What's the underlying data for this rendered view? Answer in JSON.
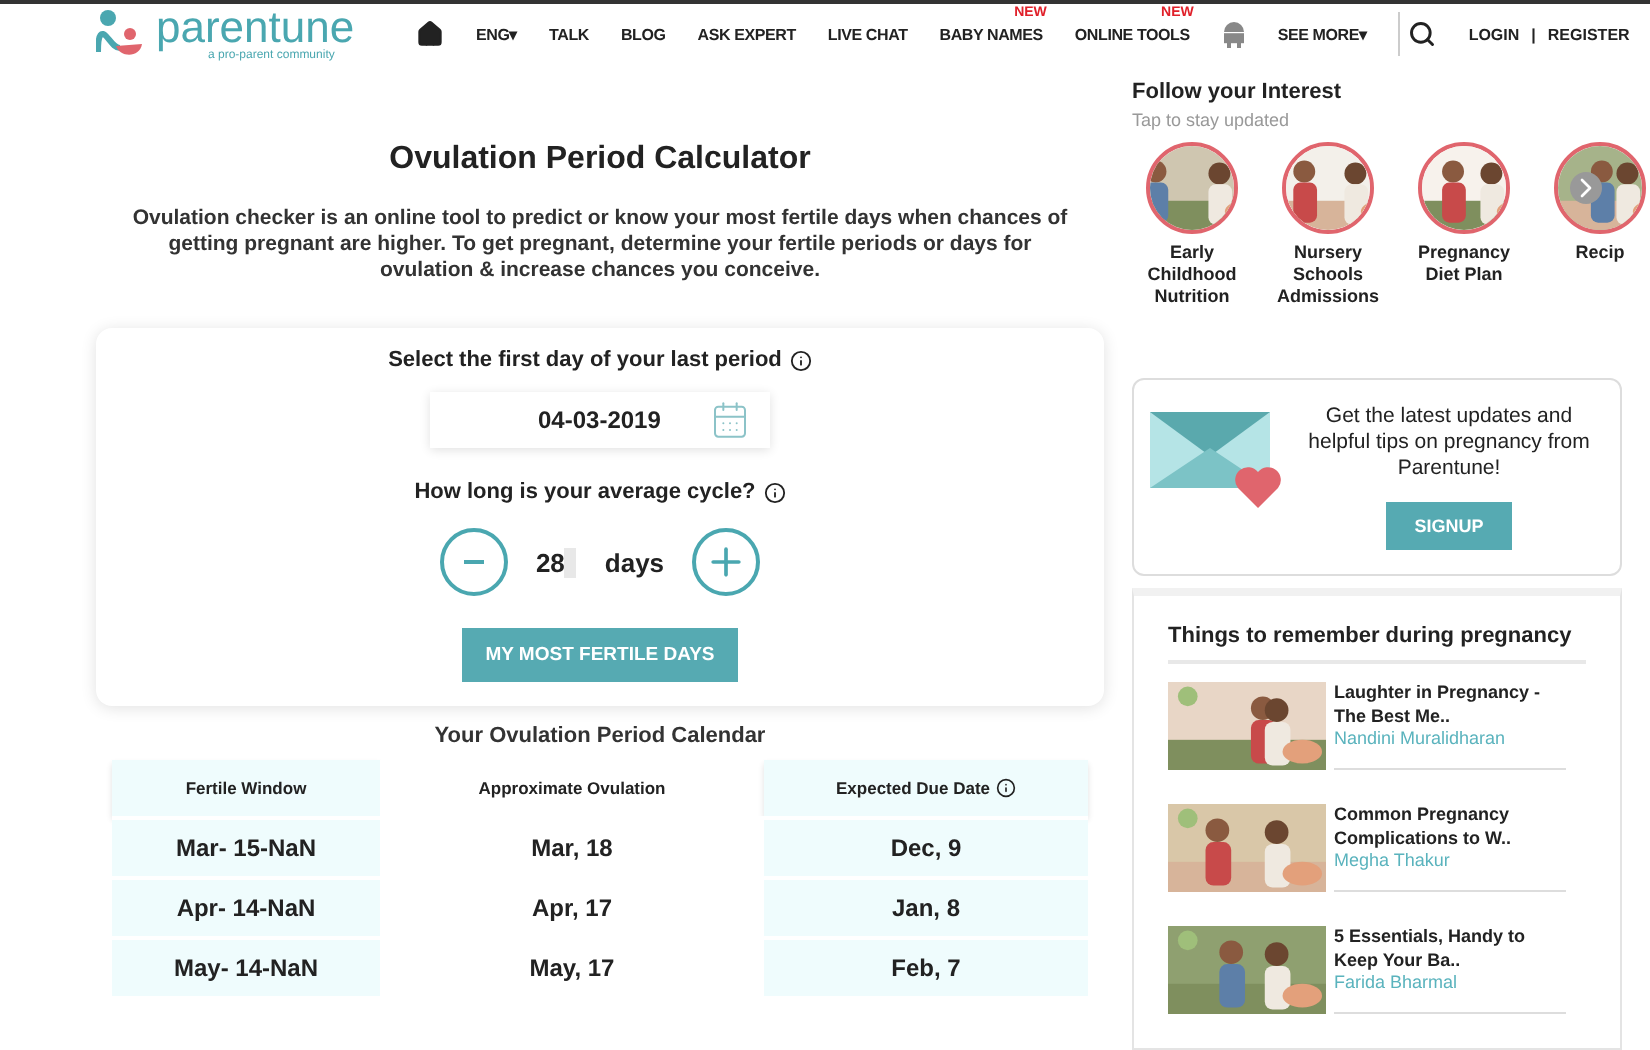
{
  "header": {
    "logo": {
      "name": "parentune",
      "tagline": "a pro-parent community"
    },
    "nav": [
      {
        "kind": "home"
      },
      {
        "kind": "link",
        "label": "ENG▾"
      },
      {
        "kind": "link",
        "label": "TALK"
      },
      {
        "kind": "link",
        "label": "BLOG"
      },
      {
        "kind": "link",
        "label": "ASK EXPERT"
      },
      {
        "kind": "link",
        "label": "LIVE CHAT"
      },
      {
        "kind": "link",
        "label": "BABY NAMES",
        "badge": "NEW"
      },
      {
        "kind": "link",
        "label": "ONLINE TOOLS",
        "badge": "NEW"
      },
      {
        "kind": "android"
      },
      {
        "kind": "link",
        "label": "SEE MORE▾"
      }
    ],
    "login": "LOGIN",
    "separator": "|",
    "register": "REGISTER"
  },
  "calculator": {
    "title": "Ovulation Period Calculator",
    "description": "Ovulation checker is an online tool to predict or know your most fertile days when chances of getting pregnant are higher. To get pregnant, determine your fertile periods or days for ovulation & increase chances you conceive.",
    "date_label": "Select the first day of your last period",
    "date_value": "04-03-2019",
    "cycle_label": "How long is your average cycle?",
    "cycle_value": "28",
    "cycle_unit": "days",
    "button": "MY MOST FERTILE DAYS"
  },
  "calendar": {
    "title": "Your Ovulation Period Calendar",
    "columns": [
      "Fertile Window",
      "Approximate Ovulation",
      "Expected Due Date"
    ],
    "rows": [
      [
        "Mar- 15-NaN",
        "Mar, 18",
        "Dec, 9"
      ],
      [
        "Apr- 14-NaN",
        "Apr, 17",
        "Jan, 8"
      ],
      [
        "May- 14-NaN",
        "May, 17",
        "Feb, 7"
      ]
    ]
  },
  "interests": {
    "title": "Follow your Interest",
    "subtitle": "Tap to stay updated",
    "items": [
      {
        "label": "Early Childhood Nutrition"
      },
      {
        "label": "Nursery Schools Admissions"
      },
      {
        "label": "Pregnancy Diet Plan"
      },
      {
        "label": "Recip"
      }
    ]
  },
  "newsletter": {
    "text": "Get the latest updates and helpful tips on pregnancy from Parentune!",
    "button": "SIGNUP"
  },
  "articles": {
    "title": "Things to remember during pregnancy",
    "items": [
      {
        "title": "Laughter in Pregnancy - The Best Me..",
        "author": "Nandini Muralidharan"
      },
      {
        "title": "Common Pregnancy Complications to W..",
        "author": "Megha Thakur"
      },
      {
        "title": "5 Essentials, Handy to Keep Your Ba..",
        "author": "Farida Bharmal"
      }
    ]
  }
}
